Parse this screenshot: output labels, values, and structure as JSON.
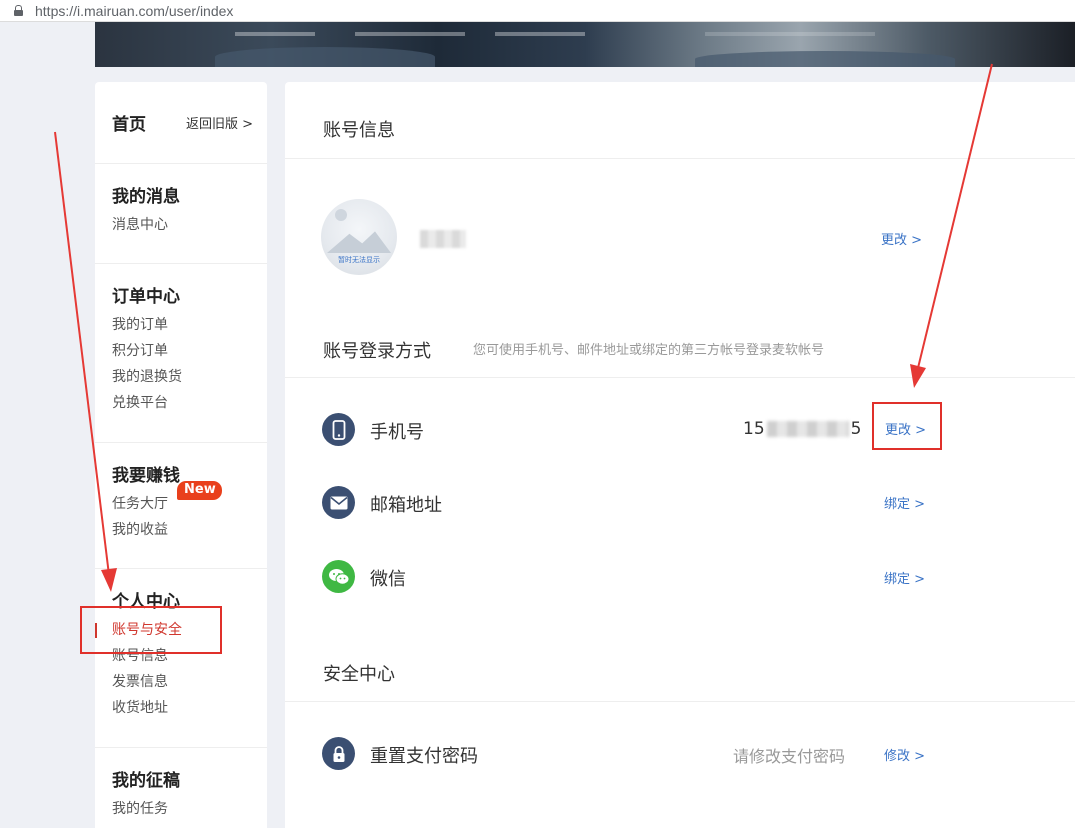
{
  "browser": {
    "url": "https://i.mairuan.com/user/index"
  },
  "sidebar": {
    "home": {
      "title": "首页",
      "back_link": "返回旧版 >"
    },
    "groups": [
      {
        "title": "我的消息",
        "items": [
          "消息中心"
        ]
      },
      {
        "title": "订单中心",
        "items": [
          "我的订单",
          "积分订单",
          "我的退换货",
          "兑换平台"
        ]
      },
      {
        "title": "我要赚钱",
        "items": [
          "任务大厅",
          "我的收益"
        ],
        "badge": "New"
      },
      {
        "title": "个人中心",
        "items": [
          "账号与安全",
          "账号信息",
          "发票信息",
          "收货地址"
        ],
        "active_item": "账号与安全"
      },
      {
        "title": "我的征稿",
        "items": [
          "我的任务"
        ]
      }
    ]
  },
  "main": {
    "account_info": {
      "title": "账号信息",
      "avatar_caption": "暂时无法显示",
      "change_link": "更改 >"
    },
    "login_methods": {
      "title": "账号登录方式",
      "note": "您可使用手机号、邮件地址或绑定的第三方帐号登录麦软帐号",
      "rows": [
        {
          "label": "手机号",
          "value_start": "15",
          "value_end": "5",
          "action": "更改 >"
        },
        {
          "label": "邮箱地址",
          "action": "绑定 >"
        },
        {
          "label": "微信",
          "action": "绑定 >"
        }
      ]
    },
    "security": {
      "title": "安全中心",
      "rows": [
        {
          "label": "重置支付密码",
          "hint": "请修改支付密码",
          "action": "修改 >"
        }
      ]
    }
  },
  "colors": {
    "accent_red": "#d0372e",
    "link_blue": "#3a73c6",
    "icon_navy": "#3b4f72",
    "wechat_green": "#3fb843",
    "badge_orange": "#e9401c"
  }
}
